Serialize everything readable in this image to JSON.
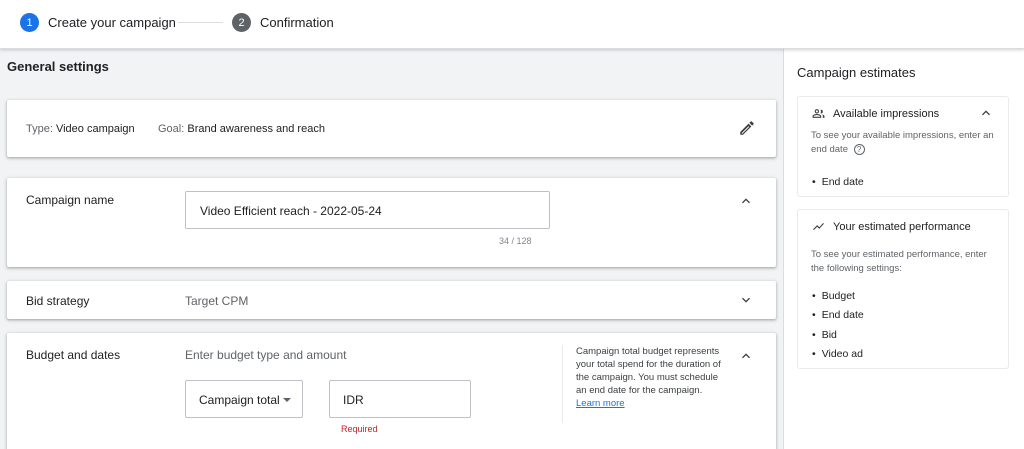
{
  "stepper": {
    "steps": [
      {
        "number": "1",
        "label": "Create your campaign"
      },
      {
        "number": "2",
        "label": "Confirmation"
      }
    ]
  },
  "main": {
    "section_title": "General settings",
    "type_card": {
      "type_label": "Type:",
      "type_value": "Video campaign",
      "goal_label": "Goal:",
      "goal_value": "Brand awareness and reach",
      "edit_icon": "pencil-icon"
    },
    "campaign_name": {
      "label": "Campaign name",
      "value": "Video Efficient reach - 2022-05-24",
      "char_count": "34 / 128"
    },
    "bid_strategy": {
      "label": "Bid strategy",
      "value": "Target CPM"
    },
    "budget": {
      "label": "Budget and dates",
      "hint": "Enter budget type and amount",
      "budget_type": "Campaign total",
      "currency_placeholder": "IDR",
      "required_text": "Required",
      "note": "Campaign total budget represents your total spend for the duration of the campaign. You must schedule an end date for the campaign.",
      "learn_more": "Learn more"
    }
  },
  "side": {
    "title": "Campaign estimates",
    "impressions": {
      "title": "Available impressions",
      "body": "To see your available impressions, enter an end date",
      "items": [
        "End date"
      ]
    },
    "performance": {
      "title": "Your estimated performance",
      "body": "To see your estimated performance, enter the following settings:",
      "items": [
        "Budget",
        "End date",
        "Bid",
        "Video ad"
      ]
    }
  },
  "colors": {
    "accent": "#1a73e8",
    "error": "#c5221f"
  }
}
